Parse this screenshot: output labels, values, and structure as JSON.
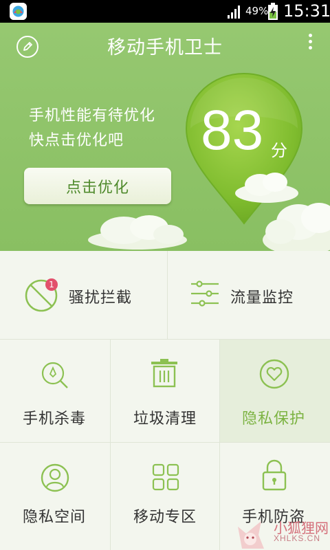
{
  "status_bar": {
    "battery_percent": "49%",
    "time": "15:31",
    "icons": [
      "app-shield-icon",
      "signal-icon",
      "battery-charging-icon"
    ]
  },
  "header": {
    "title": "移动手机卫士",
    "status_line1": "手机性能有待优化",
    "status_line2": "快点击优化吧",
    "optimize_button": "点击优化",
    "score": "83",
    "score_unit": "分",
    "icons": [
      "edit-icon",
      "more-vertical-icon"
    ]
  },
  "features": [
    {
      "label": "骚扰拦截",
      "icon": "block-icon",
      "badge": "1"
    },
    {
      "label": "流量监控",
      "icon": "sliders-icon"
    },
    {
      "label": "手机杀毒",
      "icon": "virus-scan-icon"
    },
    {
      "label": "垃圾清理",
      "icon": "trash-icon"
    },
    {
      "label": "隐私保护",
      "icon": "heart-shield-icon",
      "active": true
    },
    {
      "label": "隐私空间",
      "icon": "user-icon"
    },
    {
      "label": "移动专区",
      "icon": "grid-icon"
    },
    {
      "label": "手机防盗",
      "icon": "lock-icon"
    }
  ],
  "watermark": {
    "text": "小狐狸网",
    "site": "XHLKS.CN"
  },
  "colors": {
    "header_green": "#8fc369",
    "accent_green": "#7cb342",
    "badge_red": "#e2506c"
  }
}
